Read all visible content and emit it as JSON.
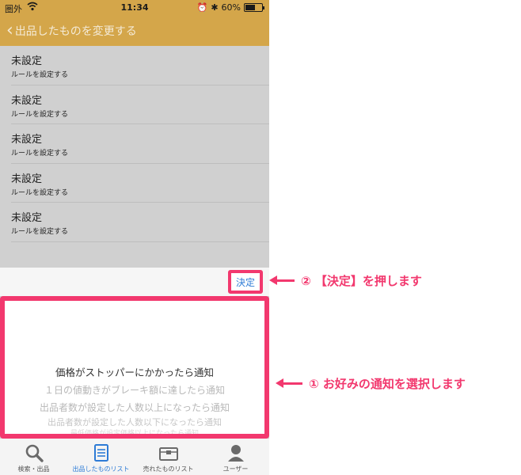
{
  "status_bar": {
    "carrier": "圏外",
    "time": "11:34",
    "battery": "60%",
    "battery_level": 0.6
  },
  "nav": {
    "back_title": "出品したものを変更する"
  },
  "list": {
    "items": [
      {
        "title": "未設定",
        "subtitle": "ルールを設定する"
      },
      {
        "title": "未設定",
        "subtitle": "ルールを設定する"
      },
      {
        "title": "未設定",
        "subtitle": "ルールを設定する"
      },
      {
        "title": "未設定",
        "subtitle": "ルールを設定する"
      },
      {
        "title": "未設定",
        "subtitle": "ルールを設定する"
      }
    ]
  },
  "toolbar": {
    "decide_label": "決定"
  },
  "picker": {
    "options": [
      "価格がストッパーにかかったら通知",
      "１日の値動きがブレーキ額に達したら通知",
      "出品者数が設定した人数以上になったら通知",
      "出品者数が設定した人数以下になったら通知",
      "最低価格が設定価格以上になったら通知"
    ],
    "selected_index": 0
  },
  "tabs": [
    {
      "label": "検索・出品",
      "icon": "search-icon"
    },
    {
      "label": "出品したものリスト",
      "icon": "list-icon"
    },
    {
      "label": "売れたものリスト",
      "icon": "box-icon"
    },
    {
      "label": "ユーザー",
      "icon": "user-icon"
    }
  ],
  "annotations": {
    "step2": "② 【決定】を押します",
    "step1": "① お好みの通知を選択します"
  },
  "colors": {
    "accent": "#d4a64a",
    "highlight": "#f2386e",
    "link_blue": "#2d7bd6"
  }
}
